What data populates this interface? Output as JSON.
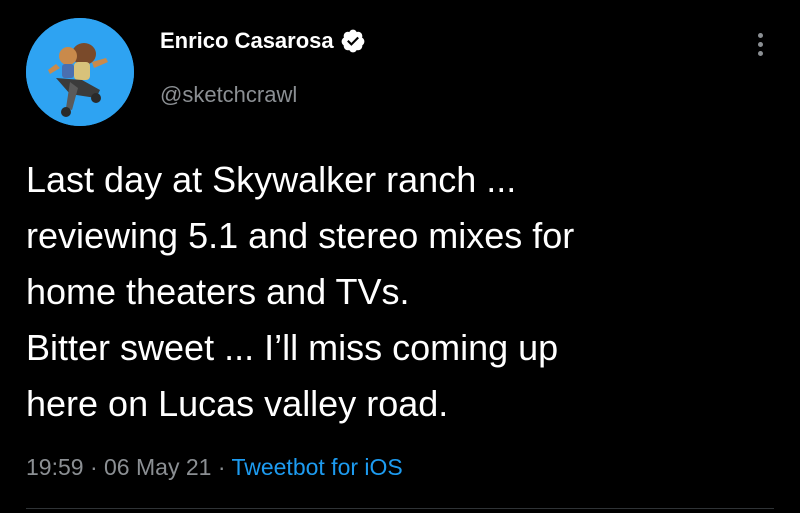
{
  "author": {
    "name": "Enrico Casarosa",
    "handle": "@sketchcrawl",
    "verified_icon": "verified-badge-icon"
  },
  "tweet": {
    "lines": [
      "Last day at Skywalker ranch ...",
      "reviewing 5.1 and stereo mixes for",
      "home theaters and TVs.",
      "Bitter sweet ... I’ll miss coming up",
      "here on Lucas valley road."
    ]
  },
  "meta": {
    "time": "19:59",
    "separator": "·",
    "date": "06 May 21",
    "source": "Tweetbot for iOS"
  },
  "colors": {
    "background": "#000000",
    "name": "#ffffff",
    "muted": "#8b8f93",
    "link": "#1d9bf0",
    "avatar_bg": "#2ea3f2"
  }
}
